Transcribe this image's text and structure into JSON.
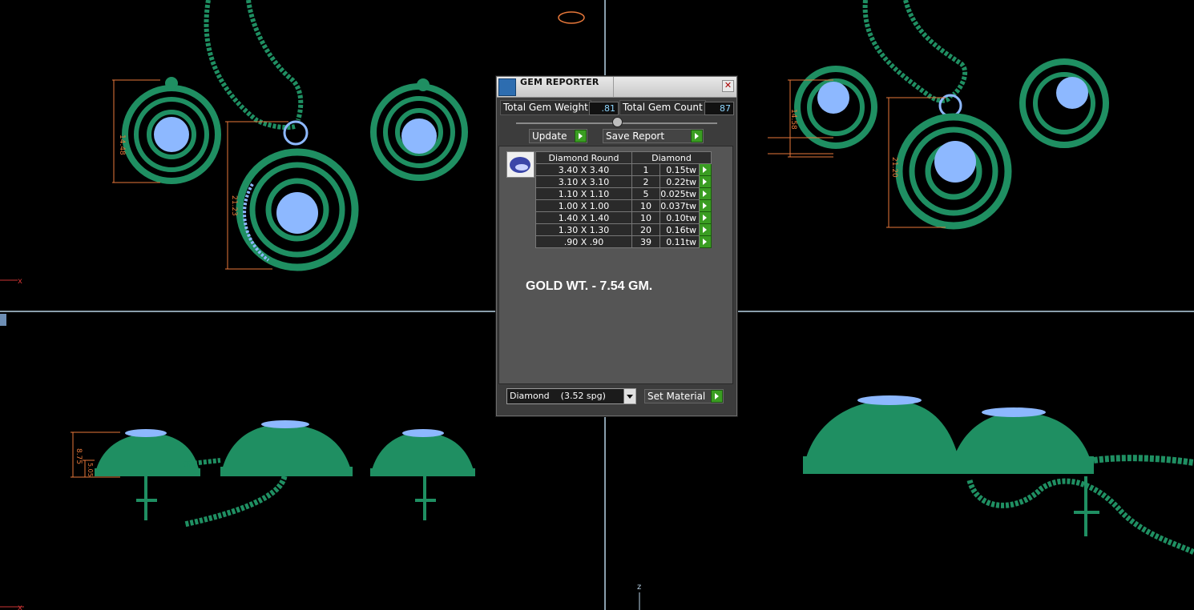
{
  "dialog": {
    "title": "GEM REPORTER",
    "close_glyph": "✕",
    "total_weight_label": "Total Gem Weight",
    "total_weight_value": ".81",
    "total_count_label": "Total Gem Count",
    "total_count_value": "87",
    "update_label": "Update",
    "save_report_label": "Save Report",
    "table": {
      "header_shape": "Diamond Round",
      "header_material": "Diamond",
      "rows": [
        {
          "size": "3.40 X 3.40",
          "count": "1",
          "weight": "0.15tw"
        },
        {
          "size": "3.10 X 3.10",
          "count": "2",
          "weight": "0.22tw"
        },
        {
          "size": "1.10 X 1.10",
          "count": "5",
          "weight": "0.025tw"
        },
        {
          "size": "1.00 X 1.00",
          "count": "10",
          "weight": "0.037tw"
        },
        {
          "size": "1.40 X 1.40",
          "count": "10",
          "weight": "0.10tw"
        },
        {
          "size": "1.30 X 1.30",
          "count": "20",
          "weight": "0.16tw"
        },
        {
          "size": ".90 X .90",
          "count": "39",
          "weight": "0.11tw"
        }
      ]
    },
    "note": "GOLD WT. - 7.54 GM.",
    "material_select": "Diamond    (3.52 spg)",
    "set_material_label": "Set Material"
  },
  "viewports": {
    "dimensions": [
      "14.48",
      "21.23",
      "21.20",
      "14.58",
      "8.75",
      "5.05"
    ],
    "axis_labels": {
      "x1": "x",
      "x2": "x",
      "z": "z"
    }
  },
  "colors": {
    "metal": "#1f8f62",
    "gem": "#8db8ff",
    "dim": "#e8783a",
    "divider": "#b8d2e6"
  }
}
